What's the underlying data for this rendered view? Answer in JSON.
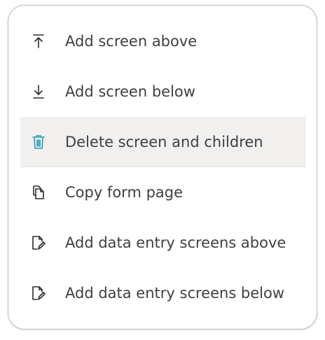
{
  "menu": {
    "items": [
      {
        "label": "Add screen above",
        "icon": "arrow-up-to-line-icon"
      },
      {
        "label": "Add screen below",
        "icon": "arrow-down-to-line-icon"
      },
      {
        "label": "Delete screen and children",
        "icon": "trash-icon",
        "highlighted": true,
        "icon_color": "#2a9bb7"
      },
      {
        "label": "Copy form page",
        "icon": "copy-icon"
      },
      {
        "label": "Add data entry screens above",
        "icon": "file-edit-icon"
      },
      {
        "label": "Add data entry screens below",
        "icon": "file-edit-icon"
      }
    ]
  },
  "colors": {
    "text": "#3f3f3f",
    "highlight_bg": "#f1f0ee",
    "delete_icon": "#2a9bb7",
    "border": "#b9b9b9"
  }
}
